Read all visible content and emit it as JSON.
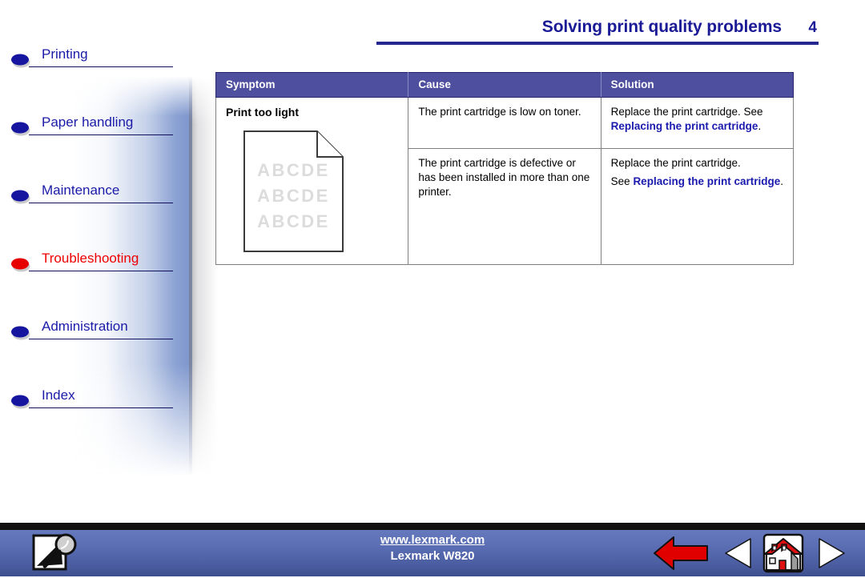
{
  "header": {
    "title": "Solving print quality problems",
    "page_number": "4",
    "rule_color": "#26268f",
    "title_color": "#1a1a96"
  },
  "sidebar": {
    "active_color": "#ee0000",
    "link_color": "#1a1aa8",
    "items": [
      {
        "label": "Printing",
        "icon": "bullet-ellipse-icon",
        "active": false
      },
      {
        "label": "Paper handling",
        "icon": "bullet-ellipse-icon",
        "active": false
      },
      {
        "label": "Maintenance",
        "icon": "bullet-ellipse-icon",
        "active": false
      },
      {
        "label": "Troubleshooting",
        "icon": "bullet-ellipse-icon",
        "active": true
      },
      {
        "label": "Administration",
        "icon": "bullet-ellipse-icon",
        "active": false
      },
      {
        "label": "Index",
        "icon": "bullet-ellipse-icon",
        "active": false
      }
    ]
  },
  "table": {
    "header_bg": "#4f4fa0",
    "columns": [
      "Symptom",
      "Cause",
      "Solution"
    ],
    "symptom": {
      "title": "Print too light",
      "illustration": {
        "icon": "printed-page-icon",
        "lines": [
          "ABCDE",
          "ABCDE",
          "ABCDE"
        ],
        "text_color": "#dcdcdc"
      }
    },
    "rows": [
      {
        "cause": "The print cartridge is low on toner.",
        "solution_prefix": "Replace the print cartridge. See ",
        "solution_link": "Replacing the print cartridge",
        "solution_suffix": ".",
        "solution_line2_prefix": "",
        "solution_line2_link": "",
        "solution_line2_suffix": ""
      },
      {
        "cause": "The print cartridge is defective or has been installed in more than one printer.",
        "solution_prefix": "Replace the print cartridge.",
        "solution_link": "",
        "solution_suffix": "",
        "solution_line2_prefix": "See ",
        "solution_line2_link": "Replacing the print cartridge",
        "solution_line2_suffix": "."
      }
    ],
    "link_color": "#1a1aae"
  },
  "footer": {
    "url": "www.lexmark.com",
    "model": "Lexmark W820",
    "buttons": [
      {
        "name": "search-button",
        "icon": "magnifier-page-icon"
      },
      {
        "name": "back-button",
        "icon": "red-left-arrow-icon"
      },
      {
        "name": "previous-button",
        "icon": "left-triangle-icon"
      },
      {
        "name": "home-button",
        "icon": "house-icon"
      },
      {
        "name": "next-button",
        "icon": "right-triangle-icon"
      }
    ],
    "bar_color": "#5b6eb4"
  }
}
